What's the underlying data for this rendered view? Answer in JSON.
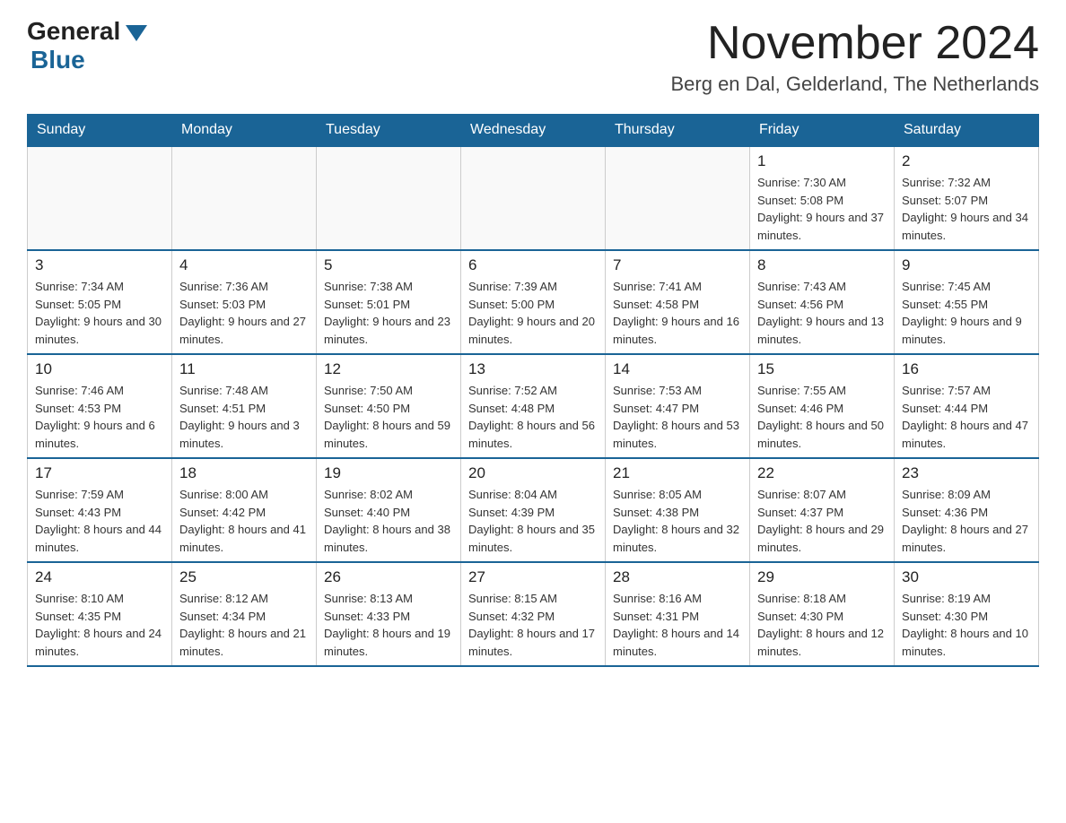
{
  "header": {
    "logo_general": "General",
    "logo_blue": "Blue",
    "month_title": "November 2024",
    "location": "Berg en Dal, Gelderland, The Netherlands"
  },
  "calendar": {
    "days_of_week": [
      "Sunday",
      "Monday",
      "Tuesday",
      "Wednesday",
      "Thursday",
      "Friday",
      "Saturday"
    ],
    "weeks": [
      [
        {
          "day": "",
          "info": ""
        },
        {
          "day": "",
          "info": ""
        },
        {
          "day": "",
          "info": ""
        },
        {
          "day": "",
          "info": ""
        },
        {
          "day": "",
          "info": ""
        },
        {
          "day": "1",
          "info": "Sunrise: 7:30 AM\nSunset: 5:08 PM\nDaylight: 9 hours and 37 minutes."
        },
        {
          "day": "2",
          "info": "Sunrise: 7:32 AM\nSunset: 5:07 PM\nDaylight: 9 hours and 34 minutes."
        }
      ],
      [
        {
          "day": "3",
          "info": "Sunrise: 7:34 AM\nSunset: 5:05 PM\nDaylight: 9 hours and 30 minutes."
        },
        {
          "day": "4",
          "info": "Sunrise: 7:36 AM\nSunset: 5:03 PM\nDaylight: 9 hours and 27 minutes."
        },
        {
          "day": "5",
          "info": "Sunrise: 7:38 AM\nSunset: 5:01 PM\nDaylight: 9 hours and 23 minutes."
        },
        {
          "day": "6",
          "info": "Sunrise: 7:39 AM\nSunset: 5:00 PM\nDaylight: 9 hours and 20 minutes."
        },
        {
          "day": "7",
          "info": "Sunrise: 7:41 AM\nSunset: 4:58 PM\nDaylight: 9 hours and 16 minutes."
        },
        {
          "day": "8",
          "info": "Sunrise: 7:43 AM\nSunset: 4:56 PM\nDaylight: 9 hours and 13 minutes."
        },
        {
          "day": "9",
          "info": "Sunrise: 7:45 AM\nSunset: 4:55 PM\nDaylight: 9 hours and 9 minutes."
        }
      ],
      [
        {
          "day": "10",
          "info": "Sunrise: 7:46 AM\nSunset: 4:53 PM\nDaylight: 9 hours and 6 minutes."
        },
        {
          "day": "11",
          "info": "Sunrise: 7:48 AM\nSunset: 4:51 PM\nDaylight: 9 hours and 3 minutes."
        },
        {
          "day": "12",
          "info": "Sunrise: 7:50 AM\nSunset: 4:50 PM\nDaylight: 8 hours and 59 minutes."
        },
        {
          "day": "13",
          "info": "Sunrise: 7:52 AM\nSunset: 4:48 PM\nDaylight: 8 hours and 56 minutes."
        },
        {
          "day": "14",
          "info": "Sunrise: 7:53 AM\nSunset: 4:47 PM\nDaylight: 8 hours and 53 minutes."
        },
        {
          "day": "15",
          "info": "Sunrise: 7:55 AM\nSunset: 4:46 PM\nDaylight: 8 hours and 50 minutes."
        },
        {
          "day": "16",
          "info": "Sunrise: 7:57 AM\nSunset: 4:44 PM\nDaylight: 8 hours and 47 minutes."
        }
      ],
      [
        {
          "day": "17",
          "info": "Sunrise: 7:59 AM\nSunset: 4:43 PM\nDaylight: 8 hours and 44 minutes."
        },
        {
          "day": "18",
          "info": "Sunrise: 8:00 AM\nSunset: 4:42 PM\nDaylight: 8 hours and 41 minutes."
        },
        {
          "day": "19",
          "info": "Sunrise: 8:02 AM\nSunset: 4:40 PM\nDaylight: 8 hours and 38 minutes."
        },
        {
          "day": "20",
          "info": "Sunrise: 8:04 AM\nSunset: 4:39 PM\nDaylight: 8 hours and 35 minutes."
        },
        {
          "day": "21",
          "info": "Sunrise: 8:05 AM\nSunset: 4:38 PM\nDaylight: 8 hours and 32 minutes."
        },
        {
          "day": "22",
          "info": "Sunrise: 8:07 AM\nSunset: 4:37 PM\nDaylight: 8 hours and 29 minutes."
        },
        {
          "day": "23",
          "info": "Sunrise: 8:09 AM\nSunset: 4:36 PM\nDaylight: 8 hours and 27 minutes."
        }
      ],
      [
        {
          "day": "24",
          "info": "Sunrise: 8:10 AM\nSunset: 4:35 PM\nDaylight: 8 hours and 24 minutes."
        },
        {
          "day": "25",
          "info": "Sunrise: 8:12 AM\nSunset: 4:34 PM\nDaylight: 8 hours and 21 minutes."
        },
        {
          "day": "26",
          "info": "Sunrise: 8:13 AM\nSunset: 4:33 PM\nDaylight: 8 hours and 19 minutes."
        },
        {
          "day": "27",
          "info": "Sunrise: 8:15 AM\nSunset: 4:32 PM\nDaylight: 8 hours and 17 minutes."
        },
        {
          "day": "28",
          "info": "Sunrise: 8:16 AM\nSunset: 4:31 PM\nDaylight: 8 hours and 14 minutes."
        },
        {
          "day": "29",
          "info": "Sunrise: 8:18 AM\nSunset: 4:30 PM\nDaylight: 8 hours and 12 minutes."
        },
        {
          "day": "30",
          "info": "Sunrise: 8:19 AM\nSunset: 4:30 PM\nDaylight: 8 hours and 10 minutes."
        }
      ]
    ]
  }
}
